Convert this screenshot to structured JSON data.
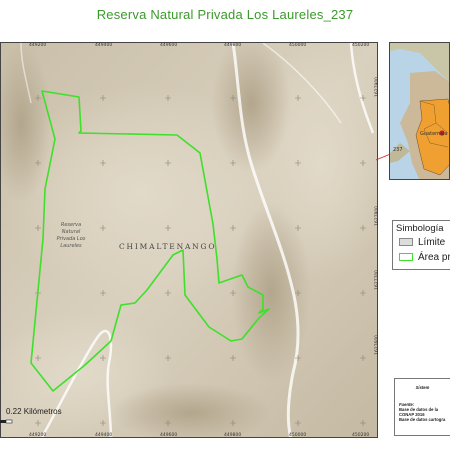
{
  "title": "Reserva Natural Privada Los Laureles_237",
  "map": {
    "region_label": "CHIMALTENANGO",
    "reserve_label_lines": [
      "Reserva",
      "Natural",
      "Privada Los",
      "Laureles"
    ],
    "x_ticks": [
      "449200",
      "449400",
      "449600",
      "449800",
      "450000",
      "450200"
    ],
    "y_ticks": [
      "1627900",
      "1627800",
      "1627700",
      "1627600"
    ],
    "scale_label": "0.22 Kilómetros",
    "colors": {
      "boundary": "#3ee02a",
      "terrain": "#d6cdbb",
      "road": "#ffffff"
    }
  },
  "inset": {
    "label": "Guatemala",
    "pointer_label": "237"
  },
  "legend": {
    "title": "Simbología",
    "items": [
      {
        "label": "Límite",
        "swatch_color": "#dddddd",
        "border_color": "#888888"
      },
      {
        "label": "Área pr",
        "swatch_color": "#ffffff",
        "border_color": "#3ee02a"
      }
    ]
  },
  "info_box": {
    "heading": "Sistem",
    "source_label": "Fuente:",
    "lines": [
      "Base de datos de la",
      "CONAP 2016",
      "Base de datos cartogra"
    ]
  }
}
